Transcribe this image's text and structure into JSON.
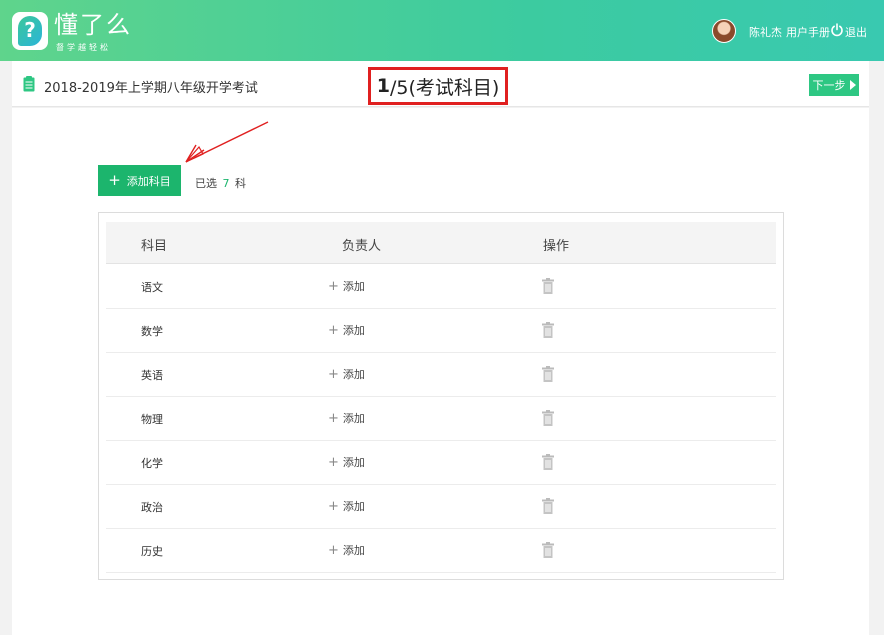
{
  "header": {
    "brand": "懂了么",
    "brand_sub": "督学越轻松",
    "user_name": "陈礼杰",
    "manual": "用户手册",
    "logout": "退出"
  },
  "subbar": {
    "exam_title": "2018-2019年上学期八年级开学考试",
    "step_current": "1",
    "step_rest": "/5(考试科目)",
    "next_label": "下一步"
  },
  "toolbar": {
    "add_label": "添加科目",
    "selected_prefix": "已选",
    "selected_count": "7",
    "selected_suffix": "科"
  },
  "table": {
    "headers": [
      "科目",
      "负责人",
      "操作"
    ],
    "add_owner_label": "添加",
    "rows": [
      {
        "subject": "语文"
      },
      {
        "subject": "数学"
      },
      {
        "subject": "英语"
      },
      {
        "subject": "物理"
      },
      {
        "subject": "化学"
      },
      {
        "subject": "政治"
      },
      {
        "subject": "历史"
      }
    ]
  },
  "colors": {
    "primary": "#1cb56d",
    "header_gradient_start": "#5fd48c",
    "header_gradient_end": "#39c9b0",
    "highlight_border": "#e02020"
  }
}
